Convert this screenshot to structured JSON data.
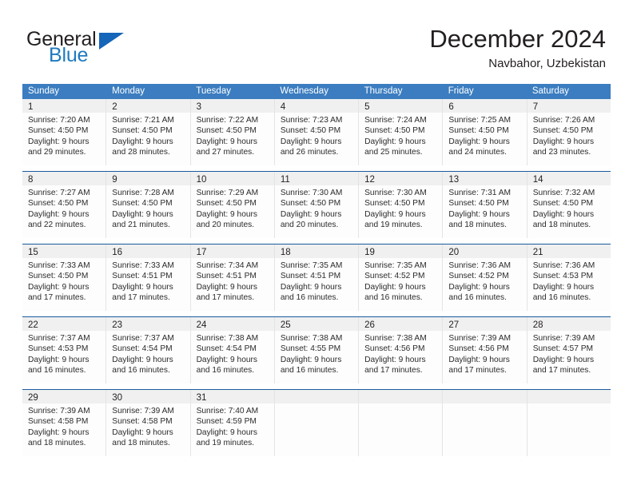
{
  "logo": {
    "text_top": "General",
    "text_bottom": "Blue",
    "icon": "triangle-icon",
    "color_dark": "#231f20",
    "color_blue": "#1f7ac0"
  },
  "header": {
    "title": "December 2024",
    "subtitle": "Navbahor, Uzbekistan"
  },
  "colors": {
    "header_blue": "#3b7dc0",
    "rule_blue": "#1a5b9e",
    "band_gray": "#f0f0f0"
  },
  "weekdays": [
    "Sunday",
    "Monday",
    "Tuesday",
    "Wednesday",
    "Thursday",
    "Friday",
    "Saturday"
  ],
  "weeks": [
    [
      {
        "day": "1",
        "sunrise": "Sunrise: 7:20 AM",
        "sunset": "Sunset: 4:50 PM",
        "daylight1": "Daylight: 9 hours",
        "daylight2": "and 29 minutes."
      },
      {
        "day": "2",
        "sunrise": "Sunrise: 7:21 AM",
        "sunset": "Sunset: 4:50 PM",
        "daylight1": "Daylight: 9 hours",
        "daylight2": "and 28 minutes."
      },
      {
        "day": "3",
        "sunrise": "Sunrise: 7:22 AM",
        "sunset": "Sunset: 4:50 PM",
        "daylight1": "Daylight: 9 hours",
        "daylight2": "and 27 minutes."
      },
      {
        "day": "4",
        "sunrise": "Sunrise: 7:23 AM",
        "sunset": "Sunset: 4:50 PM",
        "daylight1": "Daylight: 9 hours",
        "daylight2": "and 26 minutes."
      },
      {
        "day": "5",
        "sunrise": "Sunrise: 7:24 AM",
        "sunset": "Sunset: 4:50 PM",
        "daylight1": "Daylight: 9 hours",
        "daylight2": "and 25 minutes."
      },
      {
        "day": "6",
        "sunrise": "Sunrise: 7:25 AM",
        "sunset": "Sunset: 4:50 PM",
        "daylight1": "Daylight: 9 hours",
        "daylight2": "and 24 minutes."
      },
      {
        "day": "7",
        "sunrise": "Sunrise: 7:26 AM",
        "sunset": "Sunset: 4:50 PM",
        "daylight1": "Daylight: 9 hours",
        "daylight2": "and 23 minutes."
      }
    ],
    [
      {
        "day": "8",
        "sunrise": "Sunrise: 7:27 AM",
        "sunset": "Sunset: 4:50 PM",
        "daylight1": "Daylight: 9 hours",
        "daylight2": "and 22 minutes."
      },
      {
        "day": "9",
        "sunrise": "Sunrise: 7:28 AM",
        "sunset": "Sunset: 4:50 PM",
        "daylight1": "Daylight: 9 hours",
        "daylight2": "and 21 minutes."
      },
      {
        "day": "10",
        "sunrise": "Sunrise: 7:29 AM",
        "sunset": "Sunset: 4:50 PM",
        "daylight1": "Daylight: 9 hours",
        "daylight2": "and 20 minutes."
      },
      {
        "day": "11",
        "sunrise": "Sunrise: 7:30 AM",
        "sunset": "Sunset: 4:50 PM",
        "daylight1": "Daylight: 9 hours",
        "daylight2": "and 20 minutes."
      },
      {
        "day": "12",
        "sunrise": "Sunrise: 7:30 AM",
        "sunset": "Sunset: 4:50 PM",
        "daylight1": "Daylight: 9 hours",
        "daylight2": "and 19 minutes."
      },
      {
        "day": "13",
        "sunrise": "Sunrise: 7:31 AM",
        "sunset": "Sunset: 4:50 PM",
        "daylight1": "Daylight: 9 hours",
        "daylight2": "and 18 minutes."
      },
      {
        "day": "14",
        "sunrise": "Sunrise: 7:32 AM",
        "sunset": "Sunset: 4:50 PM",
        "daylight1": "Daylight: 9 hours",
        "daylight2": "and 18 minutes."
      }
    ],
    [
      {
        "day": "15",
        "sunrise": "Sunrise: 7:33 AM",
        "sunset": "Sunset: 4:50 PM",
        "daylight1": "Daylight: 9 hours",
        "daylight2": "and 17 minutes."
      },
      {
        "day": "16",
        "sunrise": "Sunrise: 7:33 AM",
        "sunset": "Sunset: 4:51 PM",
        "daylight1": "Daylight: 9 hours",
        "daylight2": "and 17 minutes."
      },
      {
        "day": "17",
        "sunrise": "Sunrise: 7:34 AM",
        "sunset": "Sunset: 4:51 PM",
        "daylight1": "Daylight: 9 hours",
        "daylight2": "and 17 minutes."
      },
      {
        "day": "18",
        "sunrise": "Sunrise: 7:35 AM",
        "sunset": "Sunset: 4:51 PM",
        "daylight1": "Daylight: 9 hours",
        "daylight2": "and 16 minutes."
      },
      {
        "day": "19",
        "sunrise": "Sunrise: 7:35 AM",
        "sunset": "Sunset: 4:52 PM",
        "daylight1": "Daylight: 9 hours",
        "daylight2": "and 16 minutes."
      },
      {
        "day": "20",
        "sunrise": "Sunrise: 7:36 AM",
        "sunset": "Sunset: 4:52 PM",
        "daylight1": "Daylight: 9 hours",
        "daylight2": "and 16 minutes."
      },
      {
        "day": "21",
        "sunrise": "Sunrise: 7:36 AM",
        "sunset": "Sunset: 4:53 PM",
        "daylight1": "Daylight: 9 hours",
        "daylight2": "and 16 minutes."
      }
    ],
    [
      {
        "day": "22",
        "sunrise": "Sunrise: 7:37 AM",
        "sunset": "Sunset: 4:53 PM",
        "daylight1": "Daylight: 9 hours",
        "daylight2": "and 16 minutes."
      },
      {
        "day": "23",
        "sunrise": "Sunrise: 7:37 AM",
        "sunset": "Sunset: 4:54 PM",
        "daylight1": "Daylight: 9 hours",
        "daylight2": "and 16 minutes."
      },
      {
        "day": "24",
        "sunrise": "Sunrise: 7:38 AM",
        "sunset": "Sunset: 4:54 PM",
        "daylight1": "Daylight: 9 hours",
        "daylight2": "and 16 minutes."
      },
      {
        "day": "25",
        "sunrise": "Sunrise: 7:38 AM",
        "sunset": "Sunset: 4:55 PM",
        "daylight1": "Daylight: 9 hours",
        "daylight2": "and 16 minutes."
      },
      {
        "day": "26",
        "sunrise": "Sunrise: 7:38 AM",
        "sunset": "Sunset: 4:56 PM",
        "daylight1": "Daylight: 9 hours",
        "daylight2": "and 17 minutes."
      },
      {
        "day": "27",
        "sunrise": "Sunrise: 7:39 AM",
        "sunset": "Sunset: 4:56 PM",
        "daylight1": "Daylight: 9 hours",
        "daylight2": "and 17 minutes."
      },
      {
        "day": "28",
        "sunrise": "Sunrise: 7:39 AM",
        "sunset": "Sunset: 4:57 PM",
        "daylight1": "Daylight: 9 hours",
        "daylight2": "and 17 minutes."
      }
    ],
    [
      {
        "day": "29",
        "sunrise": "Sunrise: 7:39 AM",
        "sunset": "Sunset: 4:58 PM",
        "daylight1": "Daylight: 9 hours",
        "daylight2": "and 18 minutes."
      },
      {
        "day": "30",
        "sunrise": "Sunrise: 7:39 AM",
        "sunset": "Sunset: 4:58 PM",
        "daylight1": "Daylight: 9 hours",
        "daylight2": "and 18 minutes."
      },
      {
        "day": "31",
        "sunrise": "Sunrise: 7:40 AM",
        "sunset": "Sunset: 4:59 PM",
        "daylight1": "Daylight: 9 hours",
        "daylight2": "and 19 minutes."
      },
      {
        "day": "",
        "sunrise": "",
        "sunset": "",
        "daylight1": "",
        "daylight2": ""
      },
      {
        "day": "",
        "sunrise": "",
        "sunset": "",
        "daylight1": "",
        "daylight2": ""
      },
      {
        "day": "",
        "sunrise": "",
        "sunset": "",
        "daylight1": "",
        "daylight2": ""
      },
      {
        "day": "",
        "sunrise": "",
        "sunset": "",
        "daylight1": "",
        "daylight2": ""
      }
    ]
  ]
}
